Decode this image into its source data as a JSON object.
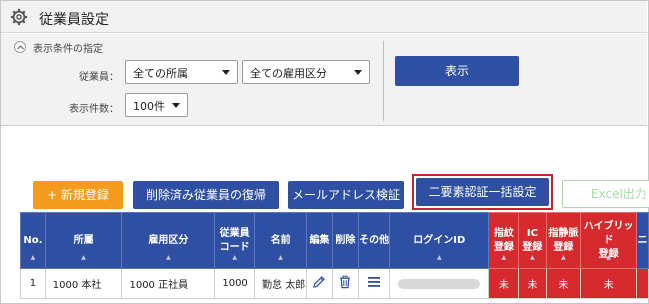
{
  "header": {
    "title": "従業員設定",
    "icon": "gear-icon"
  },
  "filter": {
    "heading": "表示条件の指定",
    "employee_label": "従業員：",
    "department_select": "全ての所属",
    "employment_select": "全ての雇用区分",
    "count_label": "表示件数：",
    "count_select": "100件",
    "show_button": "表示"
  },
  "toolbar": {
    "add": "+ 新規登録",
    "restore": "削除済み従業員の復帰",
    "verify_email": "メールアドレス検証",
    "two_factor": "二要素認証一括設定",
    "excel": "Excel出力"
  },
  "table": {
    "headers": {
      "no": "No.",
      "dept": "所屬",
      "emp_type": "雇用区分",
      "code_1": "従業員",
      "code_2": "コード",
      "name": "名前",
      "edit": "編集",
      "delete": "削除",
      "other": "その他",
      "login": "ログインID",
      "finger_1": "指紋",
      "finger_2": "登録",
      "ic_1": "IC",
      "ic_2": "登録",
      "vein_1": "指静脈",
      "vein_2": "登録",
      "hybrid_1": "ハイブリッド",
      "hybrid_2": "登録",
      "cut": "ニ"
    },
    "rows": [
      {
        "no": "1",
        "dept": "1000 本社",
        "emp_type": "1000 正社員",
        "code": "1000",
        "name": "勤怠 太郎",
        "finger": "未",
        "ic": "未",
        "vein": "未",
        "hybrid": "未"
      }
    ]
  },
  "colors": {
    "primary": "#2e4fa2",
    "accent_orange": "#f39b1c",
    "alert_red": "#d62a2f",
    "excel_green": "#a5d9a8"
  }
}
